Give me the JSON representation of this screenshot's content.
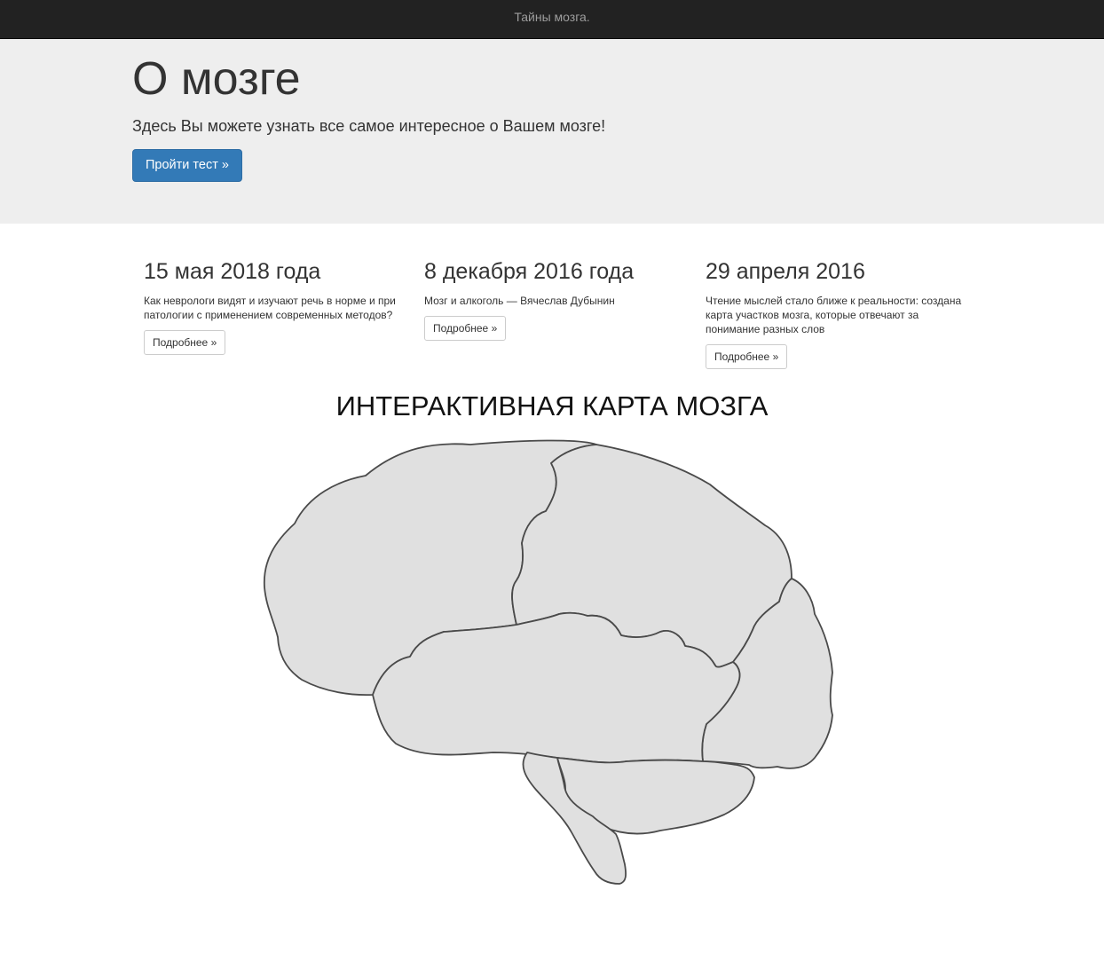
{
  "navbar": {
    "brand": "Тайны мозга."
  },
  "jumbotron": {
    "title": "О мозге",
    "lead": "Здесь Вы можете узнать все самое интересное о Вашем мозге!",
    "button_label": "Пройти тест »"
  },
  "news": [
    {
      "date": "15 мая 2018 года",
      "text": "Как неврологи видят и изучают речь в норме и при патологии с применением современных методов?",
      "button_label": "Подробнее »"
    },
    {
      "date": "8 декабря 2016 года",
      "text": "Мозг и алкоголь — Вячеслав Дубынин",
      "button_label": "Подробнее »"
    },
    {
      "date": "29 апреля 2016",
      "text": "Чтение мыслей стало ближе к реальности: создана карта участков мозга, которые отвечают за понимание разных слов",
      "button_label": "Подробнее »"
    }
  ],
  "brain_map": {
    "title": "ИНТЕРАКТИВНАЯ КАРТА МОЗГА",
    "colors": {
      "region_fill": "#e0e0e0",
      "region_stroke": "#4a4a4a"
    }
  }
}
